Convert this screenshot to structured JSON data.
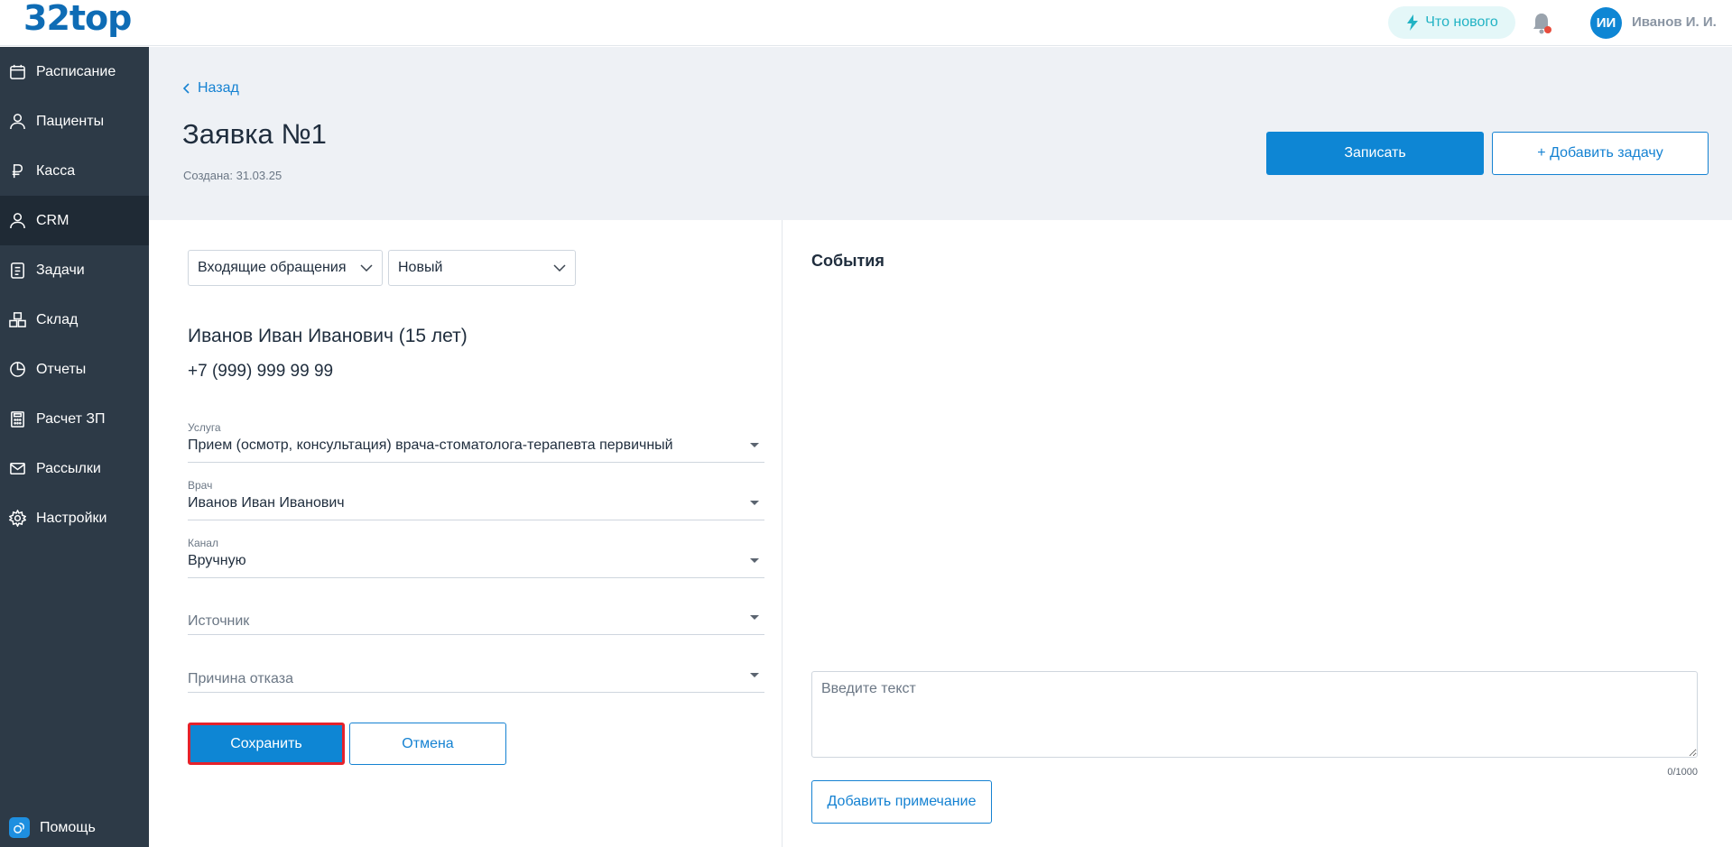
{
  "app": {
    "logo": "32top",
    "whats_new": "Что нового",
    "user_initials": "ИИ",
    "user_name": "Иванов И. И."
  },
  "sidebar": {
    "items": [
      {
        "label": "Расписание",
        "icon": "calendar-icon"
      },
      {
        "label": "Пациенты",
        "icon": "user-icon"
      },
      {
        "label": "Касса",
        "icon": "ruble-icon"
      },
      {
        "label": "CRM",
        "icon": "user-icon",
        "active": true
      },
      {
        "label": "Задачи",
        "icon": "tasks-icon"
      },
      {
        "label": "Склад",
        "icon": "boxes-icon"
      },
      {
        "label": "Отчеты",
        "icon": "pie-chart-icon"
      },
      {
        "label": "Расчет ЗП",
        "icon": "calculator-icon"
      },
      {
        "label": "Рассылки",
        "icon": "mail-icon"
      },
      {
        "label": "Настройки",
        "icon": "gear-icon"
      }
    ],
    "help": "Помощь"
  },
  "header": {
    "back": "Назад",
    "title": "Заявка №1",
    "created": "Создана: 31.03.25",
    "record_button": "Записать",
    "add_task_button": "+  Добавить задачу"
  },
  "form": {
    "category": "Входящие обращения",
    "status": "Новый",
    "patient_name": "Иванов Иван Иванович (15 лет)",
    "patient_phone": "+7 (999) 999 99 99",
    "service": {
      "label": "Услуга",
      "value": "Прием (осмотр, консультация) врача-стоматолога-терапевта первичный"
    },
    "doctor": {
      "label": "Врач",
      "value": "Иванов Иван Иванович"
    },
    "channel": {
      "label": "Канал",
      "value": "Вручную"
    },
    "source": {
      "placeholder": "Источник"
    },
    "reject_reason": {
      "placeholder": "Причина отказа"
    },
    "save_button": "Сохранить",
    "cancel_button": "Отмена"
  },
  "events": {
    "title": "События",
    "note_placeholder": "Введите текст",
    "counter": "0/1000",
    "add_note_button": "Добавить примечание"
  },
  "colors": {
    "accent": "#0e86d4",
    "sidebar": "#2d3a47",
    "highlight": "#e5222b"
  }
}
